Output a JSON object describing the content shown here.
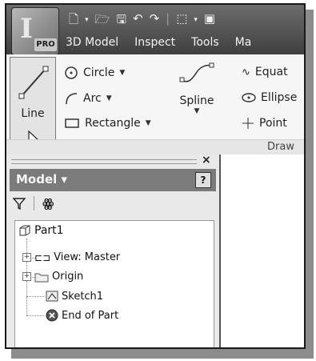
{
  "app": {
    "badge": "PRO"
  },
  "menu": [
    "3D Model",
    "Inspect",
    "Tools",
    "Ma"
  ],
  "ribbon": {
    "line_label": "Line",
    "circle_label": "Circle",
    "arc_label": "Arc",
    "rectangle_label": "Rectangle",
    "spline_label": "Spline",
    "equation_label": "Equat",
    "ellipse_label": "Ellipse",
    "point_label": "Point",
    "panel_label": "Draw"
  },
  "browser": {
    "title": "Model",
    "help": "?",
    "close": "×",
    "tree": {
      "root": "Part1",
      "items": [
        "View: Master",
        "Origin",
        "Sketch1",
        "End of Part"
      ]
    }
  },
  "colors": {
    "titlebar": "#4f4f4f",
    "ribbon": "#f6f6f6",
    "panel_header": "#7b7b7b"
  }
}
